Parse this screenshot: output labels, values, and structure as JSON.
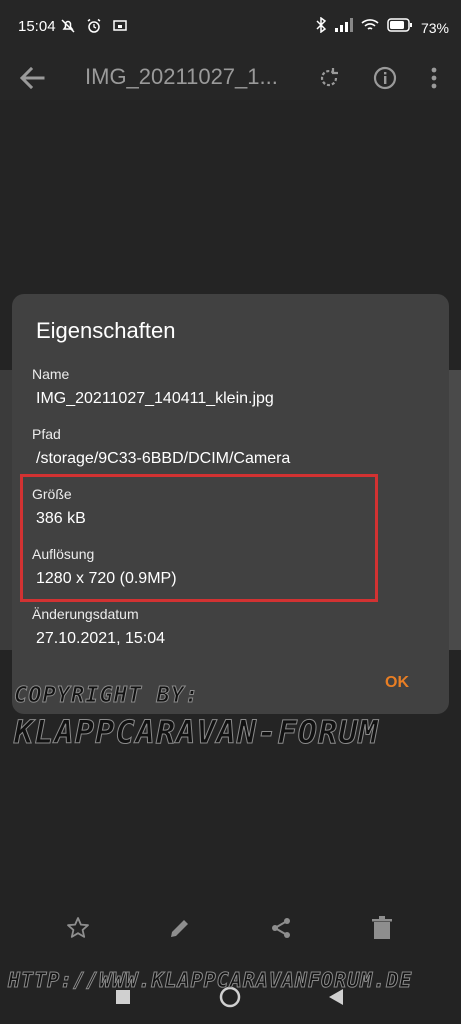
{
  "status_bar": {
    "time": "15:04",
    "battery": "73%"
  },
  "app_bar": {
    "title": "IMG_20211027_1..."
  },
  "dialog": {
    "title": "Eigenschaften",
    "fields": [
      {
        "label": "Name",
        "value": "IMG_20211027_140411_klein.jpg"
      },
      {
        "label": "Pfad",
        "value": "/storage/9C33-6BBD/DCIM/Camera"
      },
      {
        "label": "Größe",
        "value": "386 kB"
      },
      {
        "label": "Auflösung",
        "value": "1280 x 720 (0.9MP)"
      },
      {
        "label": "Änderungsdatum",
        "value": "27.10.2021, 15:04"
      }
    ],
    "ok_label": "OK"
  },
  "watermark": {
    "line1": "COPYRIGHT BY:",
    "line2": "KLAPPCARAVAN-FORUM",
    "line3": "HTTP://WWW.KLAPPCARAVANFORUM.DE"
  },
  "colors": {
    "accent": "#e87e24",
    "highlight": "#d23232",
    "dialog_bg": "#414141"
  },
  "icons": {
    "app_bar": [
      "arrow-left-icon",
      "rotate-icon",
      "info-icon",
      "more-vert-icon"
    ],
    "toolbar": [
      "star-outline-icon",
      "pencil-icon",
      "share-icon",
      "trash-icon"
    ],
    "nav": [
      "recent-apps-icon",
      "home-icon",
      "back-icon"
    ]
  }
}
